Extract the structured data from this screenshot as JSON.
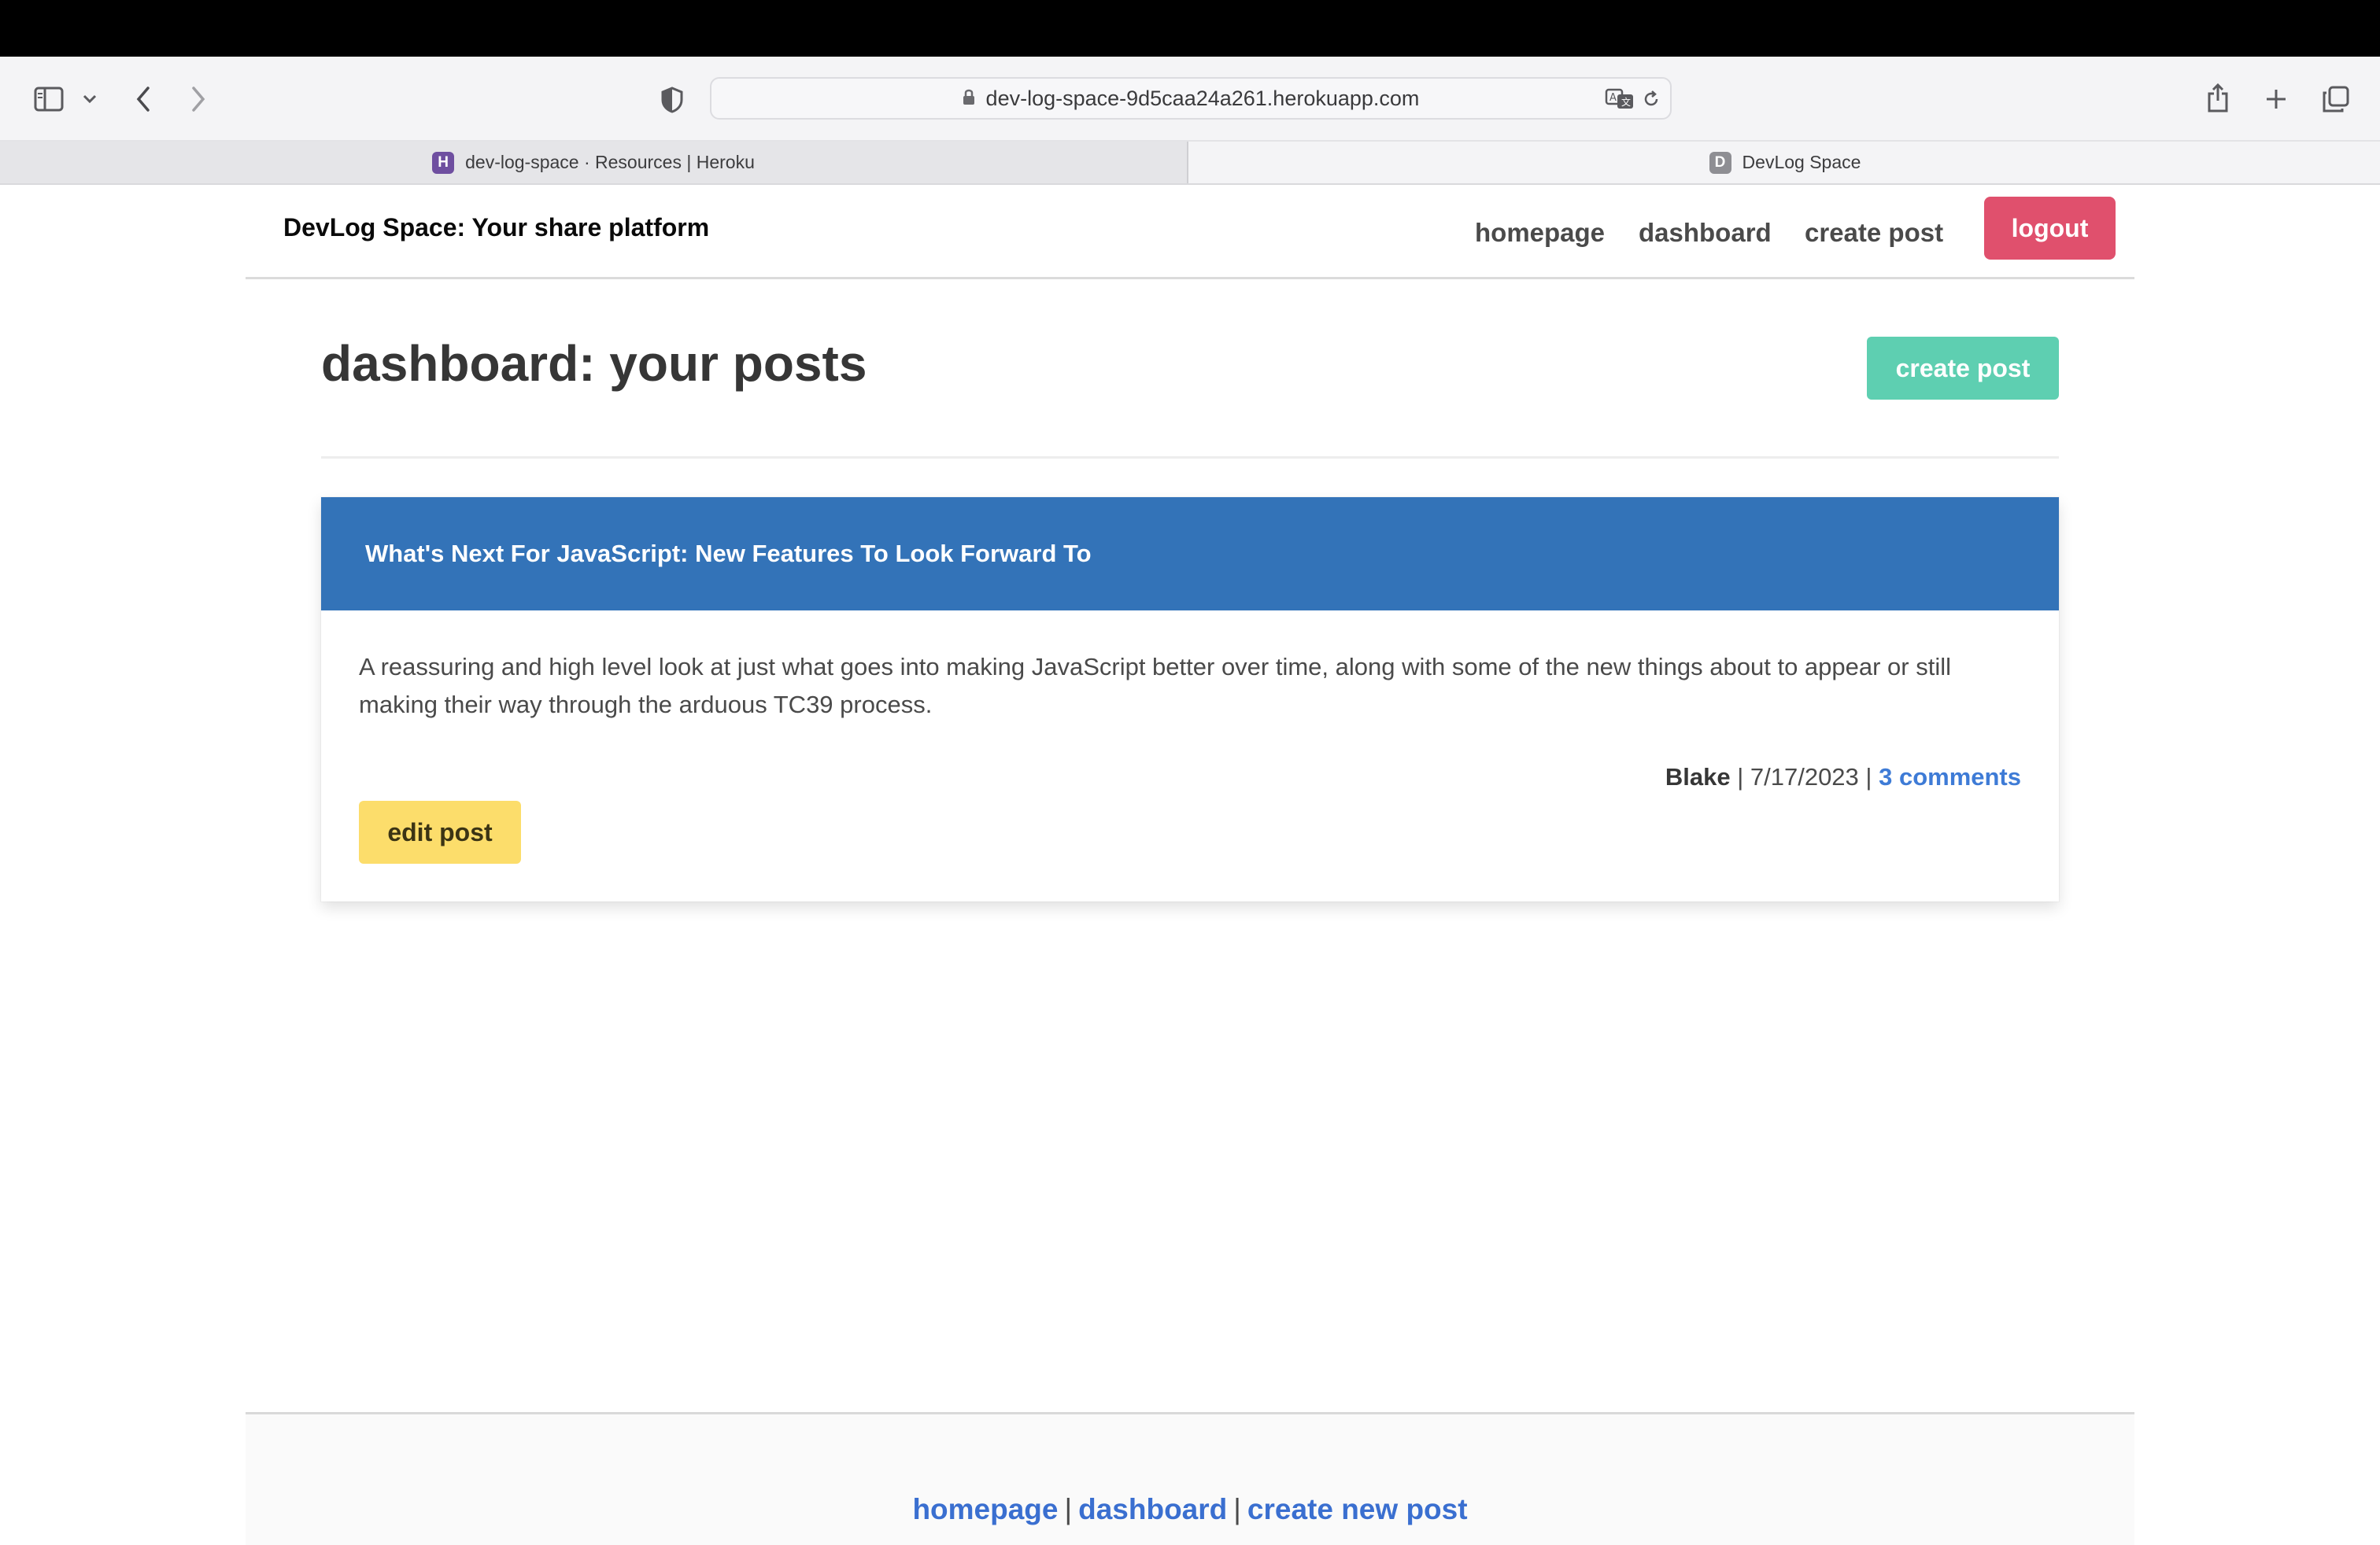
{
  "browser": {
    "url": "dev-log-space-9d5caa24a261.herokuapp.com",
    "tabs": [
      {
        "label": "dev-log-space · Resources | Heroku",
        "favicon": "H"
      },
      {
        "label": "DevLog Space",
        "favicon": "D"
      }
    ]
  },
  "navbar": {
    "brand": "DevLog Space: Your share platform",
    "links": [
      "homepage",
      "dashboard",
      "create post"
    ],
    "logout_label": "logout"
  },
  "main": {
    "title": "dashboard: your posts",
    "create_label": "create post",
    "posts": [
      {
        "title": "What's Next For JavaScript: New Features To Look Forward To",
        "body": "A reassuring and high level look at just what goes into making JavaScript better over time, along with some of the new things about to appear or still making their way through the arduous TC39 process.",
        "author": "Blake",
        "date": "7/17/2023",
        "comments": "3 comments",
        "edit_label": "edit post"
      }
    ]
  },
  "footer": {
    "links": [
      "homepage",
      "dashboard",
      "create new post"
    ],
    "separator": "|"
  },
  "colors": {
    "logout": "#e0506d",
    "create": "#5ecfb1",
    "card_header": "#3373b8",
    "edit": "#fcdd6b",
    "link": "#3a6fd0"
  }
}
